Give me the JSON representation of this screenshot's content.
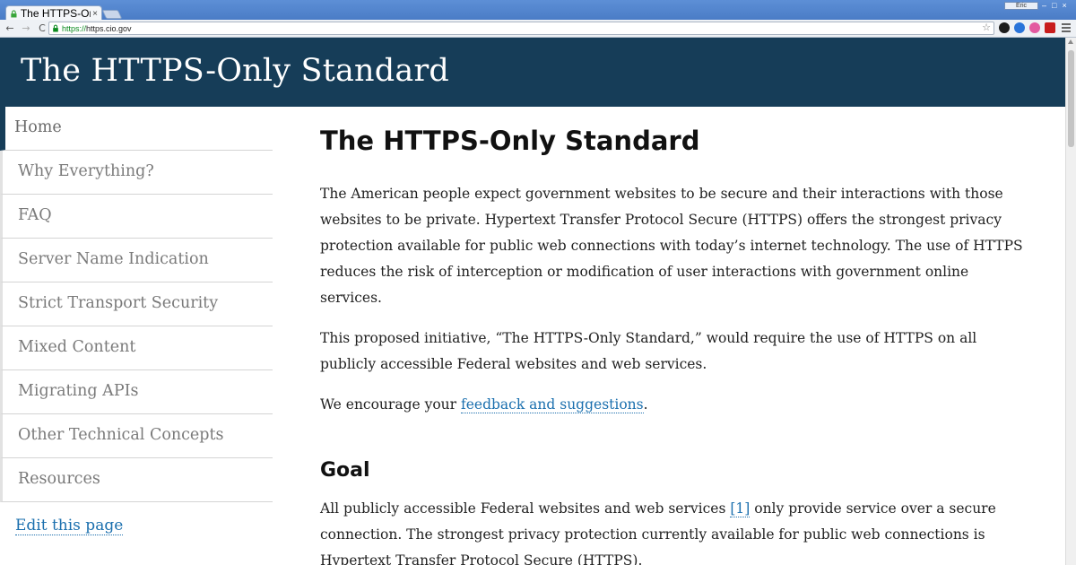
{
  "browser": {
    "tab_title": "The HTTPS-Only",
    "tab_close": "×",
    "profile_label": "Eric",
    "window_controls": [
      "–",
      "□",
      "×"
    ],
    "url_scheme": "https://",
    "url_host": "https.cio.gov",
    "nav": {
      "back": "←",
      "forward": "→",
      "reload": "C"
    },
    "star": "☆",
    "extension_colors": [
      "#1d1d1d",
      "#2a74d9",
      "#e35aa0",
      "#c81d1d"
    ]
  },
  "site": {
    "title": "The HTTPS-Only Standard"
  },
  "sidebar": {
    "items": [
      {
        "label": "Home",
        "active": true
      },
      {
        "label": "Why Everything?"
      },
      {
        "label": "FAQ"
      },
      {
        "label": "Server Name Indication"
      },
      {
        "label": "Strict Transport Security"
      },
      {
        "label": "Mixed Content"
      },
      {
        "label": "Migrating APIs"
      },
      {
        "label": "Other Technical Concepts"
      },
      {
        "label": "Resources"
      }
    ],
    "edit_link": "Edit this page"
  },
  "content": {
    "heading": "The HTTPS-Only Standard",
    "p1": "The American people expect government websites to be secure and their interactions with those websites to be private. Hypertext Transfer Protocol Secure (HTTPS) offers the strongest privacy protection available for public web connections with today’s internet technology. The use of HTTPS reduces the risk of interception or modification of user interactions with government online services.",
    "p2": "This proposed initiative, “The HTTPS-Only Standard,” would require the use of HTTPS on all publicly accessible Federal websites and web services.",
    "p3_before": "We encourage your ",
    "p3_link": "feedback and suggestions",
    "p3_after": ".",
    "goal_heading": "Goal",
    "p4_before": "All publicly accessible Federal websites and web services ",
    "p4_ref": "[1]",
    "p4_after": " only provide service over a secure connection. The strongest privacy protection currently available for public web connections is Hypertext Transfer Protocol Secure (HTTPS)."
  },
  "colors": {
    "header_bg": "#163d58",
    "link": "#1a6fae",
    "secure_green": "#0a8a1e"
  }
}
